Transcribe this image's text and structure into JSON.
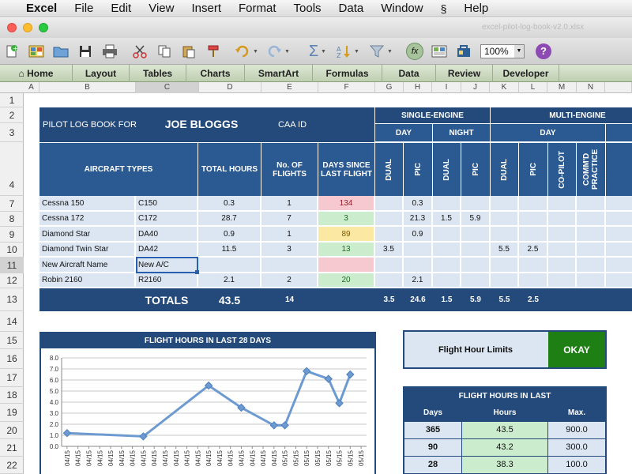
{
  "menubar": {
    "apple_glyph": "",
    "app": "Excel",
    "items": [
      "File",
      "Edit",
      "View",
      "Insert",
      "Format",
      "Tools",
      "Data",
      "Window",
      "Help"
    ]
  },
  "window": {
    "doc_title": "excel-pilot-log-book-v2.0.xlsx"
  },
  "toolbar": {
    "zoom": "100%",
    "icons": [
      "new-icon",
      "templates-icon",
      "open-icon",
      "save-icon",
      "print-icon",
      "cut-icon",
      "copy-icon",
      "paste-icon",
      "format-painter-icon",
      "undo-icon",
      "redo-icon",
      "autosum-icon",
      "sort-icon",
      "filter-icon",
      "function-icon",
      "gallery-icon",
      "toolbox-icon",
      "help-icon"
    ]
  },
  "ribbon": {
    "home_glyph": "⌂",
    "tabs": [
      "Home",
      "Layout",
      "Tables",
      "Charts",
      "SmartArt",
      "Formulas",
      "Data",
      "Review",
      "Developer"
    ]
  },
  "grid": {
    "columns": [
      "A",
      "B",
      "C",
      "D",
      "E",
      "F",
      "G",
      "H",
      "I",
      "J",
      "K",
      "L",
      "M",
      "N"
    ],
    "rows": [
      "1",
      "2",
      "3",
      "4",
      "7",
      "8",
      "9",
      "10",
      "11",
      "12",
      "13",
      "14",
      "15",
      "16",
      "17",
      "18",
      "19",
      "20",
      "21",
      "22"
    ],
    "selected_column": "C",
    "selected_row": "11"
  },
  "log": {
    "title_label": "PILOT LOG BOOK FOR",
    "pilot_name": "JOE BLOGGS",
    "caa_label": "CAA ID",
    "single_engine": "SINGLE-ENGINE",
    "multi_engine": "MULTI-ENGINE",
    "day": "DAY",
    "night": "NIGHT",
    "headers": {
      "aircraft_types": "AIRCRAFT TYPES",
      "total_hours": "TOTAL HOURS",
      "flights": "No. OF FLIGHTS",
      "days_since": "DAYS SINCE LAST FLIGHT",
      "dual": "DUAL",
      "pic": "PIC",
      "copilot": "CO-PILOT",
      "comm_practice": "COMM'D PRACTICE"
    },
    "rows": [
      {
        "name": "Cessna 150",
        "code": "C150",
        "total": "0.3",
        "flights": "1",
        "days": "134",
        "days_status": "red",
        "se_day_dual": "",
        "se_day_pic": "0.3",
        "se_night_dual": "",
        "se_night_pic": "",
        "me_day_dual": "",
        "me_day_pic": ""
      },
      {
        "name": "Cessna 172",
        "code": "C172",
        "total": "28.7",
        "flights": "7",
        "days": "3",
        "days_status": "grn",
        "se_day_dual": "",
        "se_day_pic": "21.3",
        "se_night_dual": "1.5",
        "se_night_pic": "5.9",
        "me_day_dual": "",
        "me_day_pic": ""
      },
      {
        "name": "Diamond Star",
        "code": "DA40",
        "total": "0.9",
        "flights": "1",
        "days": "89",
        "days_status": "yel",
        "se_day_dual": "",
        "se_day_pic": "0.9",
        "se_night_dual": "",
        "se_night_pic": "",
        "me_day_dual": "",
        "me_day_pic": ""
      },
      {
        "name": "Diamond Twin Star",
        "code": "DA42",
        "total": "11.5",
        "flights": "3",
        "days": "13",
        "days_status": "grn",
        "se_day_dual": "3.5",
        "se_day_pic": "",
        "se_night_dual": "",
        "se_night_pic": "",
        "me_day_dual": "5.5",
        "me_day_pic": "2.5"
      },
      {
        "name": "New Aircraft Name",
        "code": "New A/C",
        "total": "",
        "flights": "",
        "days": "",
        "days_status": "red",
        "se_day_dual": "",
        "se_day_pic": "",
        "se_night_dual": "",
        "se_night_pic": "",
        "me_day_dual": "",
        "me_day_pic": ""
      },
      {
        "name": "Robin 2160",
        "code": "R2160",
        "total": "2.1",
        "flights": "2",
        "days": "20",
        "days_status": "grn",
        "se_day_dual": "",
        "se_day_pic": "2.1",
        "se_night_dual": "",
        "se_night_pic": "",
        "me_day_dual": "",
        "me_day_pic": ""
      }
    ],
    "totals": {
      "label": "TOTALS",
      "hours": "43.5",
      "flights": "14",
      "se_day_dual": "3.5",
      "se_day_pic": "24.6",
      "se_night_dual": "1.5",
      "se_night_pic": "5.9",
      "me_day_dual": "5.5",
      "me_day_pic": "2.5"
    }
  },
  "limits": {
    "label": "Flight Hour Limits",
    "status": "OKAY",
    "status_color": "#1e7f14"
  },
  "hours_table": {
    "title": "FLIGHT HOURS IN LAST",
    "headers": [
      "Days",
      "Hours",
      "Max."
    ],
    "rows": [
      {
        "days": "365",
        "hours": "43.5",
        "max": "900.0"
      },
      {
        "days": "90",
        "hours": "43.2",
        "max": "300.0"
      },
      {
        "days": "28",
        "hours": "38.3",
        "max": "100.0"
      }
    ]
  },
  "colors": {
    "accent": "#244a7c",
    "ribbon": "#bfcfb1",
    "line": "#6d9bd1"
  },
  "chart_data": {
    "type": "line",
    "title": "FLIGHT HOURS IN LAST 28 DAYS",
    "x": [
      "04/15",
      "04/15",
      "04/15",
      "04/15",
      "04/15",
      "04/15",
      "04/15",
      "04/15",
      "04/15",
      "04/15",
      "04/15",
      "04/15",
      "04/15",
      "04/15",
      "04/15",
      "04/15",
      "04/15",
      "04/15",
      "04/15",
      "04/15",
      "05/15",
      "05/15",
      "05/15",
      "05/15",
      "05/15",
      "05/15",
      "05/15",
      "05/15"
    ],
    "series": [
      {
        "values": [
          1.2,
          null,
          null,
          null,
          null,
          null,
          null,
          0.9,
          null,
          null,
          null,
          null,
          null,
          5.5,
          null,
          null,
          3.5,
          null,
          null,
          1.9,
          1.9,
          null,
          6.8,
          null,
          6.1,
          3.9,
          6.5
        ]
      }
    ],
    "yticks": [
      "0.0",
      "1.0",
      "2.0",
      "3.0",
      "4.0",
      "5.0",
      "6.0",
      "7.0",
      "8.0"
    ],
    "ylim": [
      0,
      8
    ],
    "grid": true
  }
}
